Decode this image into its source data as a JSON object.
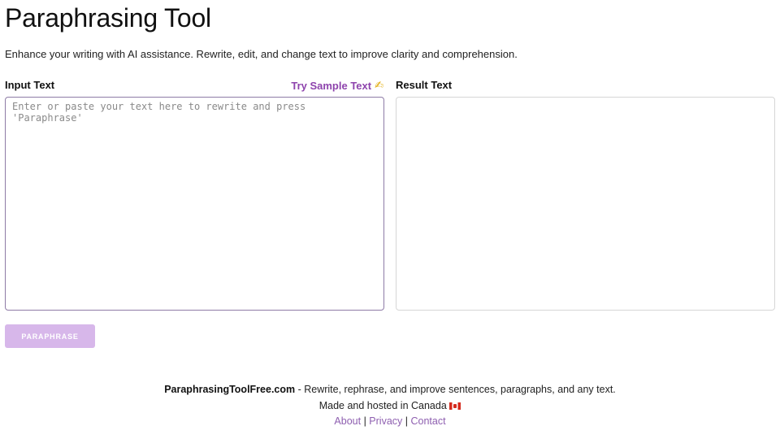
{
  "header": {
    "title": "Paraphrasing Tool",
    "subtitle": "Enhance your writing with AI assistance. Rewrite, edit, and change text to improve clarity and comprehension."
  },
  "input_panel": {
    "label": "Input Text",
    "sample_link": "Try Sample Text",
    "sample_icon": "writing-hand-icon",
    "placeholder": "Enter or paste your text here to rewrite and press 'Paraphrase'",
    "value": ""
  },
  "result_panel": {
    "label": "Result Text",
    "value": ""
  },
  "actions": {
    "paraphrase_label": "Paraphrase"
  },
  "footer": {
    "brand": "ParaphrasingToolFree.com",
    "tagline": " - Rewrite, rephrase, and improve sentences, paragraphs, and any text.",
    "hosted": "Made and hosted in Canada",
    "flag_icon": "canada-flag-icon",
    "links": [
      {
        "label": "About"
      },
      {
        "label": "Privacy"
      },
      {
        "label": "Contact"
      }
    ],
    "separator": "|"
  },
  "colors": {
    "accent": "#8e44ad",
    "button_bg": "#d7b7ea",
    "link": "#8e5fb0"
  }
}
